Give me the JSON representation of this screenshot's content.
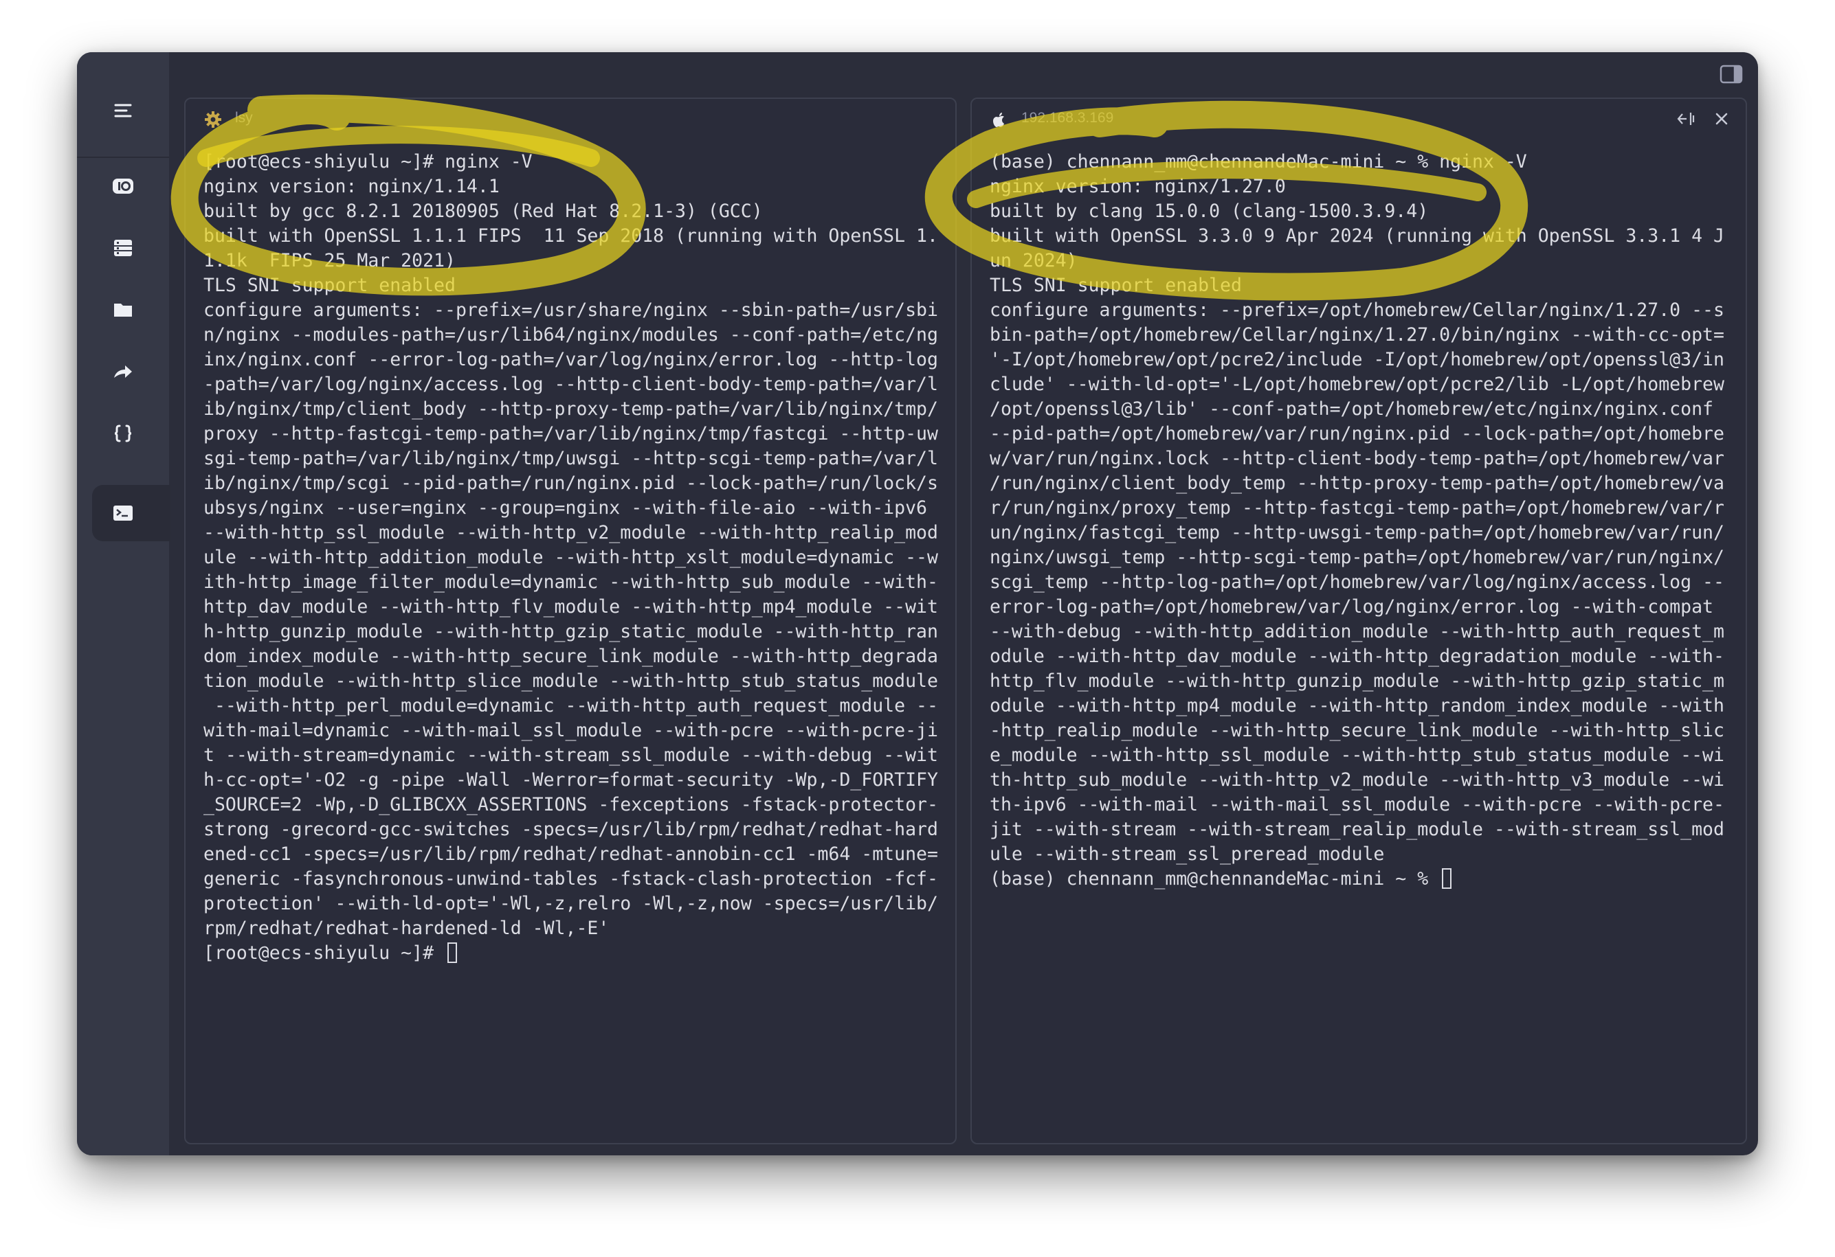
{
  "sidebar": {
    "items": [
      {
        "name": "menu-icon"
      },
      {
        "name": "sftp-icon"
      },
      {
        "name": "servers-icon"
      },
      {
        "name": "folder-icon"
      },
      {
        "name": "forward-icon"
      },
      {
        "name": "snippets-icon"
      },
      {
        "name": "terminal-icon",
        "active": true
      }
    ]
  },
  "panes": {
    "left": {
      "icon": "gear-icon",
      "title": "lsy",
      "lines": [
        "[root@ecs-shiyulu ~]# nginx -V",
        "nginx version: nginx/1.14.1",
        "built by gcc 8.2.1 20180905 (Red Hat 8.2.1-3) (GCC)",
        "built with OpenSSL 1.1.1 FIPS  11 Sep 2018 (running with OpenSSL 1.",
        "1.1k  FIPS 25 Mar 2021)",
        "TLS SNI support enabled",
        "configure arguments: --prefix=/usr/share/nginx --sbin-path=/usr/sbi",
        "n/nginx --modules-path=/usr/lib64/nginx/modules --conf-path=/etc/ng",
        "inx/nginx.conf --error-log-path=/var/log/nginx/error.log --http-log",
        "-path=/var/log/nginx/access.log --http-client-body-temp-path=/var/l",
        "ib/nginx/tmp/client_body --http-proxy-temp-path=/var/lib/nginx/tmp/",
        "proxy --http-fastcgi-temp-path=/var/lib/nginx/tmp/fastcgi --http-uw",
        "sgi-temp-path=/var/lib/nginx/tmp/uwsgi --http-scgi-temp-path=/var/l",
        "ib/nginx/tmp/scgi --pid-path=/run/nginx.pid --lock-path=/run/lock/s",
        "ubsys/nginx --user=nginx --group=nginx --with-file-aio --with-ipv6",
        "--with-http_ssl_module --with-http_v2_module --with-http_realip_mod",
        "ule --with-http_addition_module --with-http_xslt_module=dynamic --w",
        "ith-http_image_filter_module=dynamic --with-http_sub_module --with-",
        "http_dav_module --with-http_flv_module --with-http_mp4_module --wit",
        "h-http_gunzip_module --with-http_gzip_static_module --with-http_ran",
        "dom_index_module --with-http_secure_link_module --with-http_degrada",
        "tion_module --with-http_slice_module --with-http_stub_status_module",
        " --with-http_perl_module=dynamic --with-http_auth_request_module --",
        "with-mail=dynamic --with-mail_ssl_module --with-pcre --with-pcre-ji",
        "t --with-stream=dynamic --with-stream_ssl_module --with-debug --wit",
        "h-cc-opt='-O2 -g -pipe -Wall -Werror=format-security -Wp,-D_FORTIFY",
        "_SOURCE=2 -Wp,-D_GLIBCXX_ASSERTIONS -fexceptions -fstack-protector-",
        "strong -grecord-gcc-switches -specs=/usr/lib/rpm/redhat/redhat-hard",
        "ened-cc1 -specs=/usr/lib/rpm/redhat/redhat-annobin-cc1 -m64 -mtune=",
        "generic -fasynchronous-unwind-tables -fstack-clash-protection -fcf-",
        "protection' --with-ld-opt='-Wl,-z,relro -Wl,-z,now -specs=/usr/lib/",
        "rpm/redhat/redhat-hardened-ld -Wl,-E'"
      ],
      "prompt": "[root@ecs-shiyulu ~]# "
    },
    "right": {
      "icon": "apple-icon",
      "title": "192.168.3.169",
      "lines": [
        "(base) chennann_mm@chennandeMac-mini ~ % nginx -V",
        "nginx version: nginx/1.27.0",
        "built by clang 15.0.0 (clang-1500.3.9.4)",
        "built with OpenSSL 3.3.0 9 Apr 2024 (running with OpenSSL 3.3.1 4 J",
        "un 2024)",
        "TLS SNI support enabled",
        "configure arguments: --prefix=/opt/homebrew/Cellar/nginx/1.27.0 --s",
        "bin-path=/opt/homebrew/Cellar/nginx/1.27.0/bin/nginx --with-cc-opt=",
        "'-I/opt/homebrew/opt/pcre2/include -I/opt/homebrew/opt/openssl@3/in",
        "clude' --with-ld-opt='-L/opt/homebrew/opt/pcre2/lib -L/opt/homebrew",
        "/opt/openssl@3/lib' --conf-path=/opt/homebrew/etc/nginx/nginx.conf",
        "--pid-path=/opt/homebrew/var/run/nginx.pid --lock-path=/opt/homebre",
        "w/var/run/nginx.lock --http-client-body-temp-path=/opt/homebrew/var",
        "/run/nginx/client_body_temp --http-proxy-temp-path=/opt/homebrew/va",
        "r/run/nginx/proxy_temp --http-fastcgi-temp-path=/opt/homebrew/var/r",
        "un/nginx/fastcgi_temp --http-uwsgi-temp-path=/opt/homebrew/var/run/",
        "nginx/uwsgi_temp --http-scgi-temp-path=/opt/homebrew/var/run/nginx/",
        "scgi_temp --http-log-path=/opt/homebrew/var/log/nginx/access.log --",
        "error-log-path=/opt/homebrew/var/log/nginx/error.log --with-compat",
        "--with-debug --with-http_addition_module --with-http_auth_request_m",
        "odule --with-http_dav_module --with-http_degradation_module --with-",
        "http_flv_module --with-http_gunzip_module --with-http_gzip_static_m",
        "odule --with-http_mp4_module --with-http_random_index_module --with",
        "-http_realip_module --with-http_secure_link_module --with-http_slic",
        "e_module --with-http_ssl_module --with-http_stub_status_module --wi",
        "th-http_sub_module --with-http_v2_module --with-http_v3_module --wi",
        "th-ipv6 --with-mail --with-mail_ssl_module --with-pcre --with-pcre-",
        "jit --with-stream --with-stream_realip_module --with-stream_ssl_mod",
        "ule --with-stream_ssl_preread_module"
      ],
      "prompt": "(base) chennann_mm@chennandeMac-mini ~ % "
    }
  },
  "colors": {
    "highlight": "#e7d21f",
    "window_bg": "#2b2d3a",
    "sidebar_bg": "#353846",
    "text": "#dcdde4"
  }
}
